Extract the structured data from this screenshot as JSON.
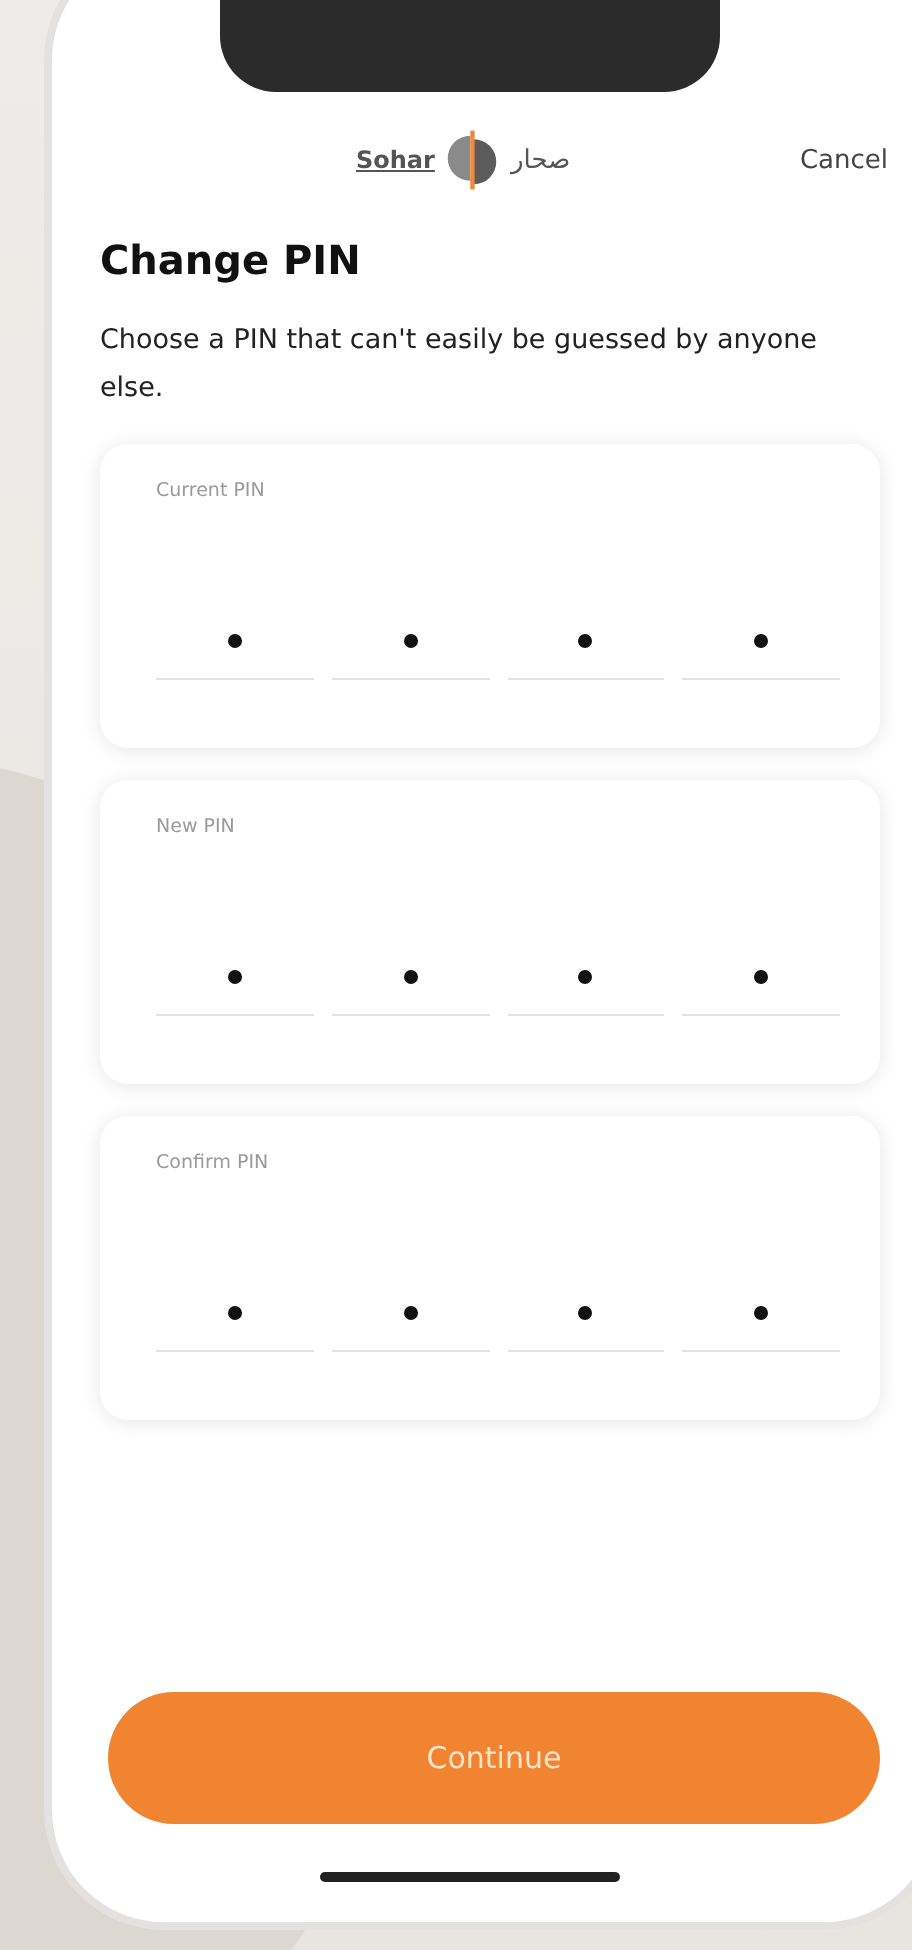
{
  "header": {
    "logo_latin": "Sohar",
    "logo_arabic": "صحار",
    "cancel": "Cancel"
  },
  "title": "Change PIN",
  "subtitle": "Choose a PIN that can't easily be guessed by anyone else.",
  "pin_fields": [
    {
      "label": "Current PIN",
      "digits": [
        {
          "filled": true
        },
        {
          "filled": true
        },
        {
          "filled": true
        },
        {
          "filled": true
        }
      ]
    },
    {
      "label": "New PIN",
      "digits": [
        {
          "filled": true
        },
        {
          "filled": true
        },
        {
          "filled": true
        },
        {
          "filled": true
        }
      ]
    },
    {
      "label": "Confirm PIN",
      "digits": [
        {
          "filled": true
        },
        {
          "filled": true
        },
        {
          "filled": true
        },
        {
          "filled": true
        }
      ]
    }
  ],
  "continue_button": "Continue"
}
